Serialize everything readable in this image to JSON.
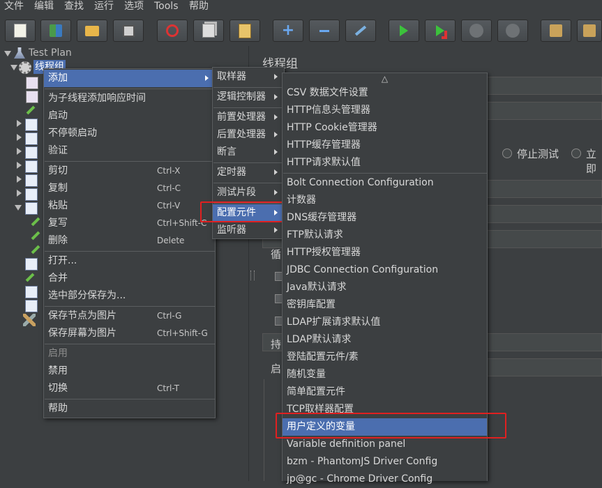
{
  "menubar": [
    "文件",
    "编辑",
    "查找",
    "运行",
    "选项",
    "Tools",
    "帮助"
  ],
  "tree": {
    "root": "Test Plan",
    "thread_group": "线程组"
  },
  "right_panel": {
    "title": "线程组",
    "stop_test": "停止测试",
    "stop_now_partial": "立即",
    "loop_partial": "循",
    "duration_partial": "持",
    "startup_partial": "启"
  },
  "context_menu": {
    "items": [
      {
        "label": "添加",
        "shortcut": "",
        "submenu": true,
        "selected": true
      },
      {
        "label": "为子线程添加响应时间",
        "shortcut": ""
      },
      {
        "label": "启动",
        "shortcut": ""
      },
      {
        "label": "不停顿启动",
        "shortcut": ""
      },
      {
        "label": "验证",
        "shortcut": ""
      },
      {
        "label": "剪切",
        "shortcut": "Ctrl-X"
      },
      {
        "label": "复制",
        "shortcut": "Ctrl-C"
      },
      {
        "label": "粘贴",
        "shortcut": "Ctrl-V"
      },
      {
        "label": "复写",
        "shortcut": "Ctrl+Shift-C"
      },
      {
        "label": "删除",
        "shortcut": "Delete"
      },
      {
        "label": "打开...",
        "shortcut": ""
      },
      {
        "label": "合并",
        "shortcut": ""
      },
      {
        "label": "选中部分保存为...",
        "shortcut": ""
      },
      {
        "label": "保存节点为图片",
        "shortcut": "Ctrl-G"
      },
      {
        "label": "保存屏幕为图片",
        "shortcut": "Ctrl+Shift-G"
      },
      {
        "label": "启用",
        "shortcut": "",
        "disabled": true
      },
      {
        "label": "禁用",
        "shortcut": ""
      },
      {
        "label": "切换",
        "shortcut": "Ctrl-T"
      },
      {
        "label": "帮助",
        "shortcut": ""
      }
    ]
  },
  "add_submenu": {
    "items": [
      "取样器",
      "逻辑控制器",
      "前置处理器",
      "后置处理器",
      "断言",
      "定时器",
      "测试片段",
      "配置元件",
      "监听器"
    ],
    "selected": "配置元件"
  },
  "config_submenu": {
    "scroll_up": "△",
    "items": [
      "CSV 数据文件设置",
      "HTTP信息头管理器",
      "HTTP Cookie管理器",
      "HTTP缓存管理器",
      "HTTP请求默认值",
      "Bolt Connection Configuration",
      "计数器",
      "DNS缓存管理器",
      "FTP默认请求",
      "HTTP授权管理器",
      "JDBC Connection Configuration",
      "Java默认请求",
      "密钥库配置",
      "LDAP扩展请求默认值",
      "LDAP默认请求",
      "登陆配置元件/素",
      "随机变量",
      "简单配置元件",
      "TCP取样器配置",
      "用户定义的变量",
      "Variable definition panel",
      "bzm - PhantomJS Driver Config",
      "jp@gc - Chrome Driver Config"
    ],
    "selected": "用户定义的变量"
  },
  "colors": {
    "background": "#3c3f41",
    "selection": "#4b6eaf",
    "highlight_box": "#e02020"
  }
}
